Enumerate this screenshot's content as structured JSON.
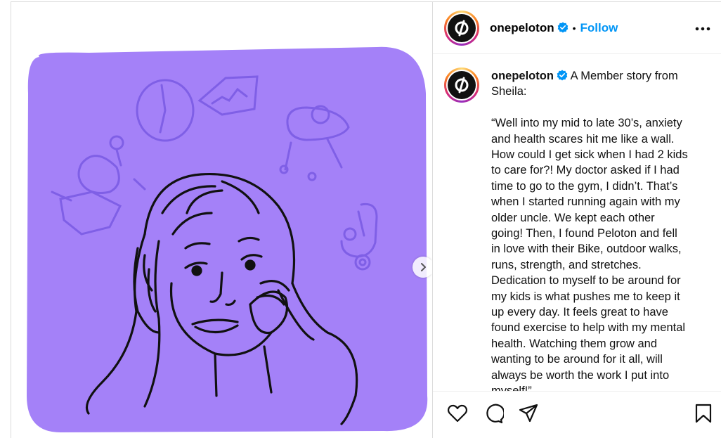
{
  "post": {
    "username": "onepeloton",
    "follow_label": "Follow",
    "separator": "•",
    "caption_lines": [
      "A Member story from",
      "Sheila:",
      "",
      "“Well into my mid to late 30’s, anxiety",
      "and health scares hit me like a wall.",
      "How could I get sick when I had 2 kids",
      "to care for?! My doctor asked if I had",
      "time to go to the gym, I didn’t. That’s",
      "when I started running again with my",
      "older uncle. We kept each other",
      "going! Then, I found Peloton and fell",
      "in love with their Bike, outdoor walks,",
      "runs, strength, and stretches.",
      "Dedication to myself to be around for",
      "my kids is what pushes me to keep it",
      "up every day. It feels great to have",
      "found exercise to help with my mental",
      "health. Watching them grow and",
      "wanting to be around for it all, will",
      "always be worth the work I put into",
      "myself!”"
    ]
  },
  "colors": {
    "illustration_bg": "#a481f8",
    "link_blue": "#0095f6",
    "verified_blue": "#0095f6"
  },
  "icons": {
    "more": "more-options-icon",
    "like": "heart-icon",
    "comment": "comment-icon",
    "share": "share-icon",
    "save": "bookmark-icon",
    "next": "chevron-right-icon"
  }
}
